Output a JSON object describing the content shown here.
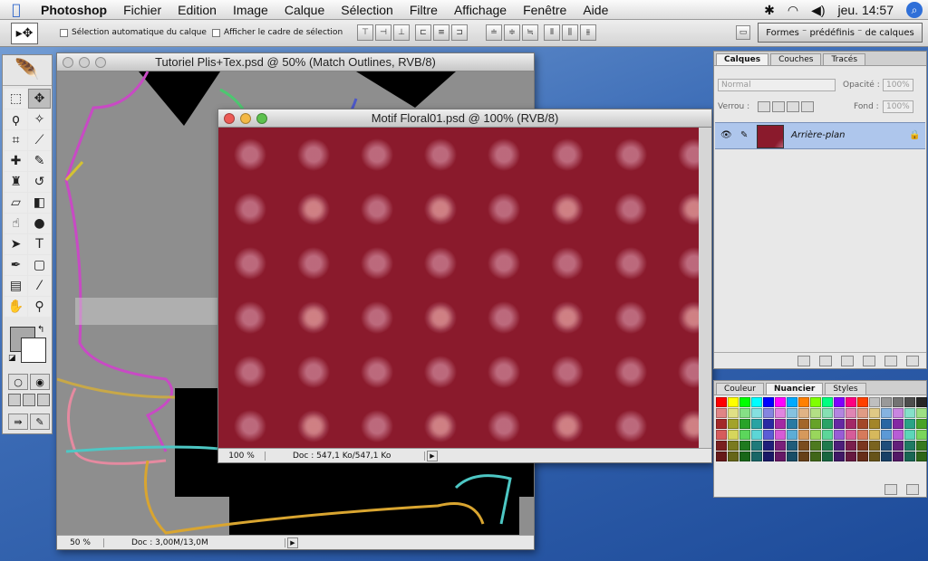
{
  "menubar": {
    "app": "Photoshop",
    "items": [
      "Fichier",
      "Edition",
      "Image",
      "Calque",
      "Sélection",
      "Filtre",
      "Affichage",
      "Fenêtre",
      "Aide"
    ],
    "clock": "jeu. 14:57"
  },
  "options": {
    "auto_select": "Sélection automatique du calque",
    "show_bbox": "Afficher le cadre de sélection",
    "presets_tab": "Formes ⁻ prédéfinis ⁻ de calques"
  },
  "win_back": {
    "title": "Tutoriel Plis+Tex.psd @ 50% (Match Outlines, RVB/8)",
    "zoom": "50 %",
    "doc": "Doc : 3,00M/13,0M"
  },
  "win_front": {
    "title": "Motif Floral01.psd @ 100% (RVB/8)",
    "zoom": "100 %",
    "doc": "Doc : 547,1 Ko/547,1 Ko"
  },
  "layers": {
    "tabs": [
      "Calques",
      "Couches",
      "Tracés"
    ],
    "blend": "Normal",
    "opacity_label": "Opacité :",
    "opacity": "100%",
    "lock_label": "Verrou :",
    "fill_label": "Fond :",
    "fill": "100%",
    "layer_name": "Arrière-plan"
  },
  "swatch_panel": {
    "tabs": [
      "Couleur",
      "Nuancier",
      "Styles"
    ]
  },
  "colors": {
    "fabric": "#8a1a2c",
    "layer_selected": "#aec6ec"
  }
}
